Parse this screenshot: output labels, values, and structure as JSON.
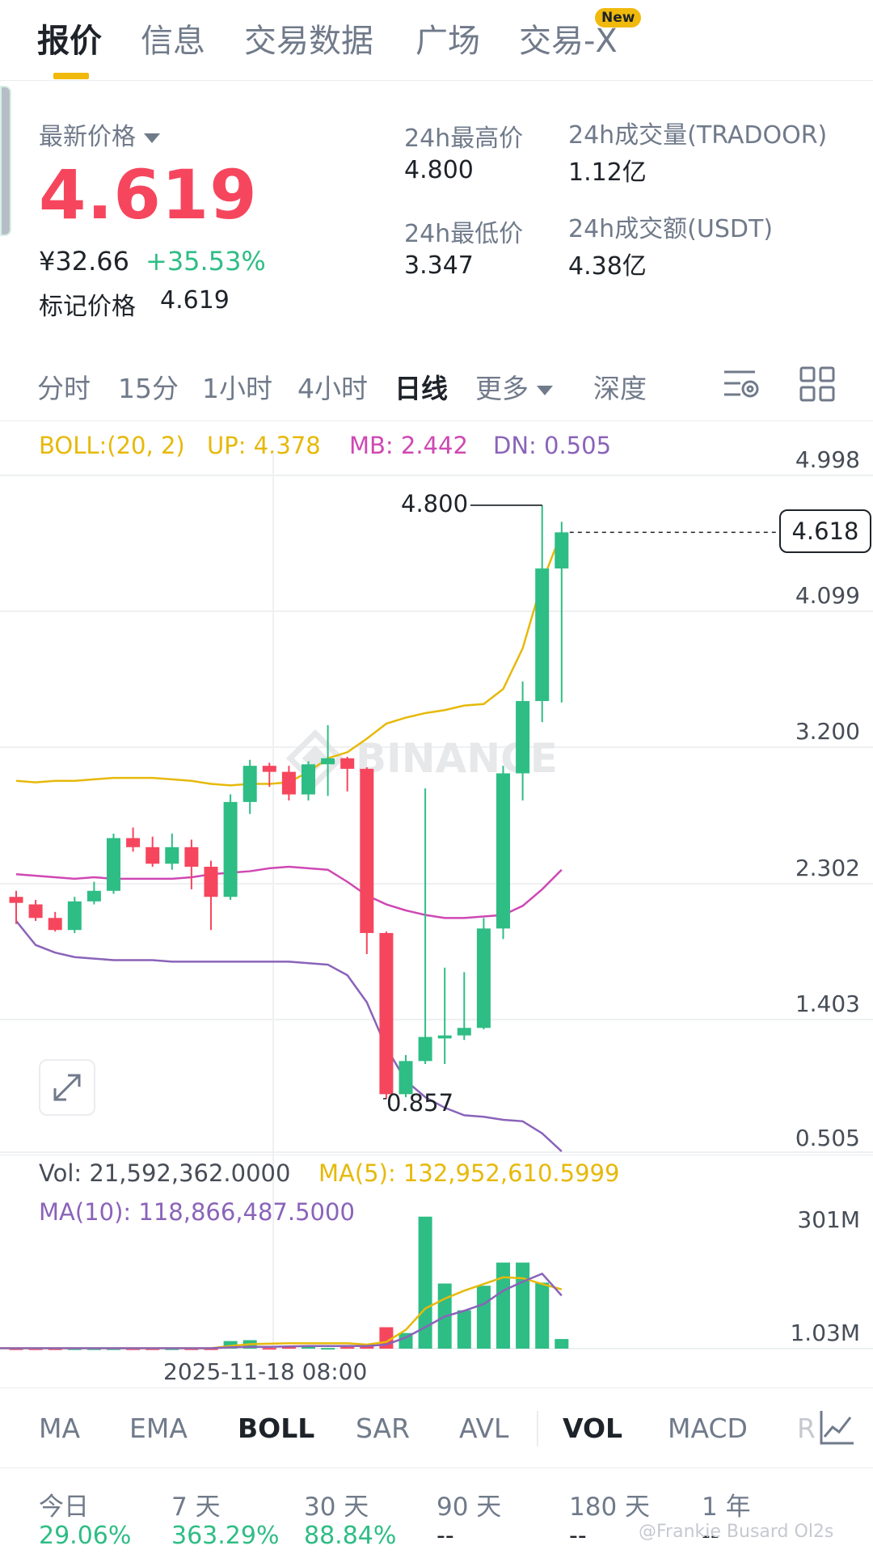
{
  "tabs": [
    {
      "label": "报价"
    },
    {
      "label": "信息"
    },
    {
      "label": "交易数据"
    },
    {
      "label": "广场"
    },
    {
      "label": "交易-X"
    }
  ],
  "new_badge": "New",
  "price": {
    "latest_label": "最新价格",
    "last": "4.619",
    "cny": "¥32.66",
    "change": "+35.53%",
    "mark_label": "标记价格",
    "mark_value": "4.619"
  },
  "stats": {
    "high_label": "24h最高价",
    "high": "4.800",
    "low_label": "24h最低价",
    "low": "3.347",
    "vol_label": "24h成交量(TRADOOR)",
    "vol": "1.12亿",
    "amount_label": "24h成交额(USDT)",
    "amount": "4.38亿"
  },
  "intervals": [
    "分时",
    "15分",
    "1小时",
    "4小时",
    "日线",
    "更多",
    "深度"
  ],
  "active_interval": "日线",
  "indicator": {
    "boll": "BOLL:(20, 2)",
    "up": "UP: 4.378",
    "mb": "MB: 2.442",
    "dn": "DN: 0.505"
  },
  "watermark": "BINANCE",
  "current_price_tag": "4.618",
  "max_label": "4.800",
  "min_label": "0.857",
  "colors": {
    "up": "#2ebd85",
    "down": "#f6465d",
    "boll_up": "#e6b90a",
    "boll_mb": "#cf48b3",
    "boll_dn": "#8a63b9",
    "accent": "#f0b90b"
  },
  "chart_data": {
    "type": "candlestick",
    "y_ticks": [
      "4.998",
      "4.099",
      "3.200",
      "2.302",
      "1.403",
      "0.505"
    ],
    "ylim": [
      0.505,
      4.998
    ],
    "x_label": "2025-11-18 08:00",
    "candles": [
      [
        2.2,
        2.16,
        2.24,
        2.02
      ],
      [
        2.15,
        2.06,
        2.18,
        2.04
      ],
      [
        2.06,
        1.98,
        2.1,
        1.97
      ],
      [
        1.98,
        2.17,
        2.2,
        1.96
      ],
      [
        2.17,
        2.24,
        2.3,
        2.15
      ],
      [
        2.24,
        2.59,
        2.62,
        2.22
      ],
      [
        2.59,
        2.53,
        2.66,
        2.5
      ],
      [
        2.53,
        2.42,
        2.6,
        2.4
      ],
      [
        2.42,
        2.53,
        2.62,
        2.38
      ],
      [
        2.53,
        2.4,
        2.58,
        2.25
      ],
      [
        2.4,
        2.2,
        2.44,
        1.98
      ],
      [
        2.2,
        2.83,
        2.88,
        2.18
      ],
      [
        2.83,
        3.07,
        3.11,
        2.75
      ],
      [
        3.07,
        3.03,
        3.09,
        2.93
      ],
      [
        3.03,
        2.88,
        3.07,
        2.84
      ],
      [
        2.88,
        3.08,
        3.1,
        2.84
      ],
      [
        3.08,
        3.12,
        3.34,
        2.87
      ],
      [
        3.12,
        3.05,
        3.13,
        2.9
      ],
      [
        3.05,
        1.96,
        3.06,
        1.82
      ],
      [
        1.96,
        0.89,
        1.97,
        0.86
      ],
      [
        0.89,
        1.11,
        1.15,
        0.87
      ],
      [
        1.11,
        1.27,
        2.92,
        1.09
      ],
      [
        1.26,
        1.28,
        1.73,
        1.09
      ],
      [
        1.28,
        1.33,
        1.7,
        1.25
      ],
      [
        1.33,
        1.99,
        2.06,
        1.32
      ],
      [
        1.99,
        3.02,
        3.07,
        1.92
      ],
      [
        3.02,
        3.5,
        3.63,
        2.84
      ],
      [
        3.5,
        4.38,
        4.8,
        3.36
      ],
      [
        4.38,
        4.62,
        4.69,
        3.49
      ]
    ],
    "boll_up": [
      2.97,
      2.96,
      2.97,
      2.97,
      2.98,
      2.99,
      2.99,
      2.99,
      2.98,
      2.97,
      2.95,
      2.94,
      2.95,
      2.95,
      2.96,
      3.03,
      3.12,
      3.16,
      3.25,
      3.35,
      3.39,
      3.42,
      3.44,
      3.47,
      3.48,
      3.58,
      3.85,
      4.29,
      4.62
    ],
    "boll_mb": [
      2.35,
      2.34,
      2.33,
      2.32,
      2.33,
      2.32,
      2.32,
      2.32,
      2.32,
      2.33,
      2.35,
      2.36,
      2.37,
      2.39,
      2.4,
      2.39,
      2.38,
      2.3,
      2.21,
      2.15,
      2.11,
      2.08,
      2.06,
      2.06,
      2.07,
      2.08,
      2.14,
      2.25,
      2.38
    ],
    "boll_dn": [
      2.04,
      1.88,
      1.83,
      1.8,
      1.79,
      1.78,
      1.78,
      1.78,
      1.77,
      1.77,
      1.77,
      1.77,
      1.77,
      1.77,
      1.77,
      1.76,
      1.75,
      1.68,
      1.5,
      1.2,
      0.98,
      0.87,
      0.8,
      0.75,
      0.74,
      0.72,
      0.71,
      0.63,
      0.51
    ],
    "volume": {
      "label": "Vol: 21,592,362.0000",
      "ma5_label": "MA(5): 132,952,610.5999",
      "ma10_label": "MA(10): 118,866,487.5000",
      "y_ticks": [
        "301M",
        "1.03M"
      ],
      "ylim": [
        1.03,
        301
      ],
      "values": [
        0.5,
        0.5,
        0.5,
        0.5,
        0.5,
        0.5,
        0.5,
        0.5,
        0.5,
        0.5,
        0.5,
        17,
        19,
        1.5,
        3.5,
        6,
        1.5,
        3.5,
        6,
        48,
        35,
        296,
        146,
        86,
        141,
        193,
        193,
        148,
        21.6
      ],
      "ma5": [
        1,
        1,
        1,
        1,
        1,
        1,
        1,
        1,
        1,
        1,
        1,
        6,
        10,
        11,
        12,
        12,
        12,
        12,
        9,
        15,
        42,
        90,
        112,
        130,
        145,
        160,
        158,
        145,
        133
      ],
      "ma10": [
        1,
        1,
        1,
        1,
        1,
        1,
        1,
        1,
        1,
        1,
        1,
        3,
        4,
        4,
        5,
        6,
        6,
        6,
        6,
        9,
        25,
        48,
        72,
        85,
        100,
        130,
        150,
        168,
        119
      ]
    }
  },
  "ind_tabs": [
    "MA",
    "EMA",
    "BOLL",
    "SAR",
    "AVL",
    "VOL",
    "MACD",
    "R"
  ],
  "active_ind": [
    "BOLL",
    "VOL"
  ],
  "performance": [
    {
      "label": "今日",
      "value": "29.06%"
    },
    {
      "label": "7 天",
      "value": "363.29%"
    },
    {
      "label": "30 天",
      "value": "88.84%"
    },
    {
      "label": "90 天",
      "value": "--"
    },
    {
      "label": "180 天",
      "value": "--"
    },
    {
      "label": "1 年",
      "value": "--"
    }
  ],
  "footer_watermark": "@Frankie Busard Ol2s"
}
